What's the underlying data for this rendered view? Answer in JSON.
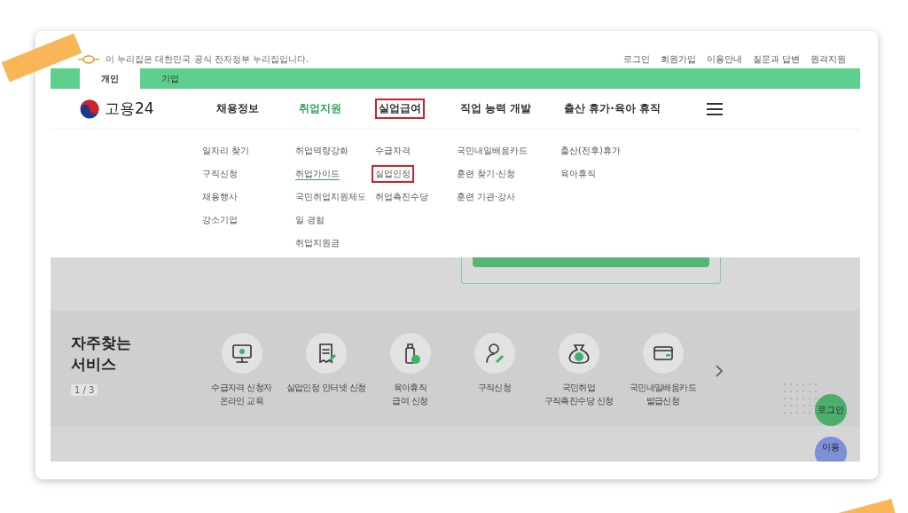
{
  "notice": {
    "text": "이 누리집은 대한민국 공식 전자정부 누리집입니다."
  },
  "utility_links": [
    "로그인",
    "회원가입",
    "이용안내",
    "질문과 답변",
    "원격지원"
  ],
  "audience_tabs": [
    {
      "label": "개인",
      "selected": true
    },
    {
      "label": "기업",
      "selected": false
    }
  ],
  "logo": {
    "text": "고용24"
  },
  "nav": [
    {
      "label": "채용정보",
      "selected": false,
      "highlighted": false,
      "children": [
        {
          "label": "일자리 찾기",
          "hovered": false,
          "highlighted": false
        },
        {
          "label": "구직신청",
          "hovered": false,
          "highlighted": false
        },
        {
          "label": "채용행사",
          "hovered": false,
          "highlighted": false
        },
        {
          "label": "강소기업",
          "hovered": false,
          "highlighted": false
        }
      ]
    },
    {
      "label": "취업지원",
      "selected": true,
      "highlighted": false,
      "children": [
        {
          "label": "취업역량강화",
          "hovered": false,
          "highlighted": false
        },
        {
          "label": "취업가이드",
          "hovered": true,
          "highlighted": false
        },
        {
          "label": "국민취업지원제도",
          "hovered": false,
          "highlighted": false
        },
        {
          "label": "일 경험",
          "hovered": false,
          "highlighted": false
        },
        {
          "label": "취업지원금",
          "hovered": false,
          "highlighted": false
        }
      ]
    },
    {
      "label": "실업급여",
      "selected": false,
      "highlighted": true,
      "children": [
        {
          "label": "수급자격",
          "hovered": false,
          "highlighted": false
        },
        {
          "label": "실업인정",
          "hovered": false,
          "highlighted": true
        },
        {
          "label": "취업촉진수당",
          "hovered": false,
          "highlighted": false
        }
      ]
    },
    {
      "label": "직업 능력 개발",
      "selected": false,
      "highlighted": false,
      "children": [
        {
          "label": "국민내일배움카드",
          "hovered": false,
          "highlighted": false
        },
        {
          "label": "훈련 찾기·신청",
          "hovered": false,
          "highlighted": false
        },
        {
          "label": "훈련 기관·강사",
          "hovered": false,
          "highlighted": false
        }
      ]
    },
    {
      "label": "출산 휴가·육아 휴직",
      "selected": false,
      "highlighted": false,
      "children": [
        {
          "label": "출산(전후)휴가",
          "hovered": false,
          "highlighted": false
        },
        {
          "label": "육아휴직",
          "hovered": false,
          "highlighted": false
        }
      ]
    }
  ],
  "services": {
    "title": "자주찾는 서비스",
    "pager": "1 / 3",
    "items": [
      {
        "label": "수급자격 신청자\n온라인 교육"
      },
      {
        "label": "실업인정 인터넷 신청"
      },
      {
        "label": "육아휴직\n급여 신청"
      },
      {
        "label": "구직신청"
      },
      {
        "label": "국민취업\n구직촉진수당 신청"
      },
      {
        "label": "국민내일배움카드\n발급신청"
      }
    ]
  },
  "float_buttons": [
    {
      "label": "로그인",
      "kind": "login"
    },
    {
      "label": "이용",
      "kind": "guide"
    }
  ]
}
